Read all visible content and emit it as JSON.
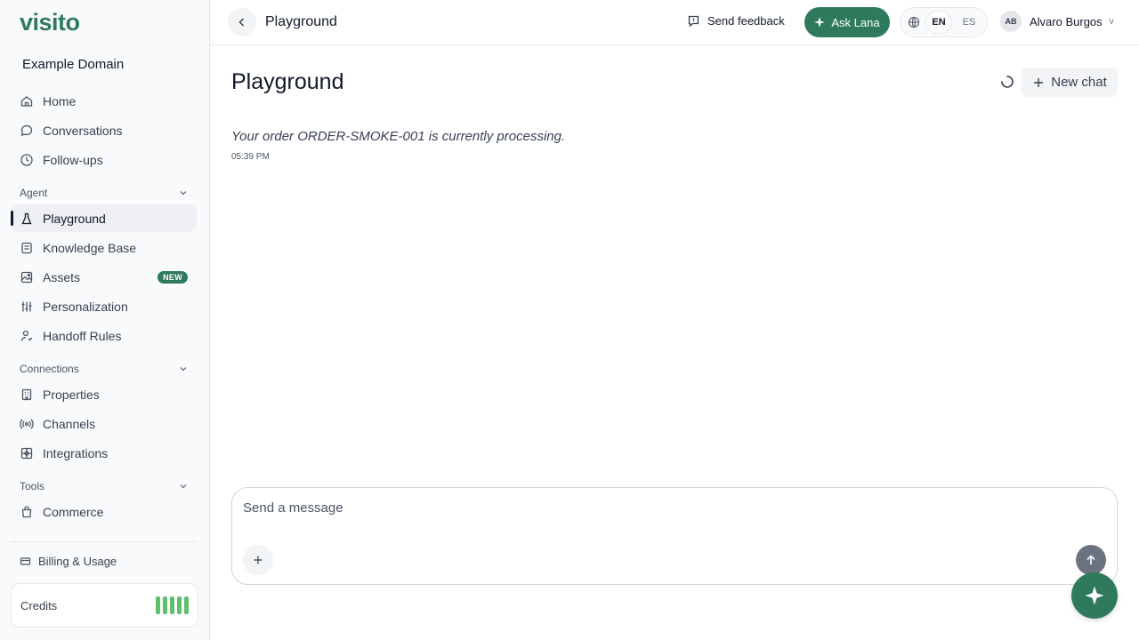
{
  "brand": {
    "logo": "visito",
    "color": "#2f7a5c"
  },
  "sidebar": {
    "domain": "Example Domain",
    "items_top": [
      {
        "label": "Home",
        "icon": "home-icon"
      },
      {
        "label": "Conversations",
        "icon": "chat-bubble-icon"
      },
      {
        "label": "Follow-ups",
        "icon": "clock-icon"
      }
    ],
    "sections": [
      {
        "label": "Agent",
        "items": [
          {
            "label": "Playground",
            "icon": "flask-icon",
            "active": true
          },
          {
            "label": "Knowledge Base",
            "icon": "book-icon"
          },
          {
            "label": "Assets",
            "icon": "image-icon",
            "badge": "NEW"
          },
          {
            "label": "Personalization",
            "icon": "sliders-icon"
          },
          {
            "label": "Handoff Rules",
            "icon": "user-handoff-icon"
          }
        ]
      },
      {
        "label": "Connections",
        "items": [
          {
            "label": "Properties",
            "icon": "building-icon"
          },
          {
            "label": "Channels",
            "icon": "broadcast-icon"
          },
          {
            "label": "Integrations",
            "icon": "puzzle-icon"
          }
        ]
      },
      {
        "label": "Tools",
        "items": [
          {
            "label": "Commerce",
            "icon": "shopping-bag-icon"
          }
        ]
      }
    ],
    "billing": "Billing & Usage",
    "credits": "Credits"
  },
  "topbar": {
    "breadcrumb": "Playground",
    "feedback": "Send feedback",
    "ask": "Ask Lana",
    "languages": [
      "EN",
      "ES"
    ],
    "active_language": "EN",
    "user_initials": "AB",
    "user_name": "Alvaro Burgos",
    "caret": "v"
  },
  "main": {
    "title": "Playground",
    "new_chat": "New chat",
    "message": "Your order ORDER-SMOKE-001 is currently processing.",
    "time": "05:39 PM",
    "input_placeholder": "Send a message"
  }
}
